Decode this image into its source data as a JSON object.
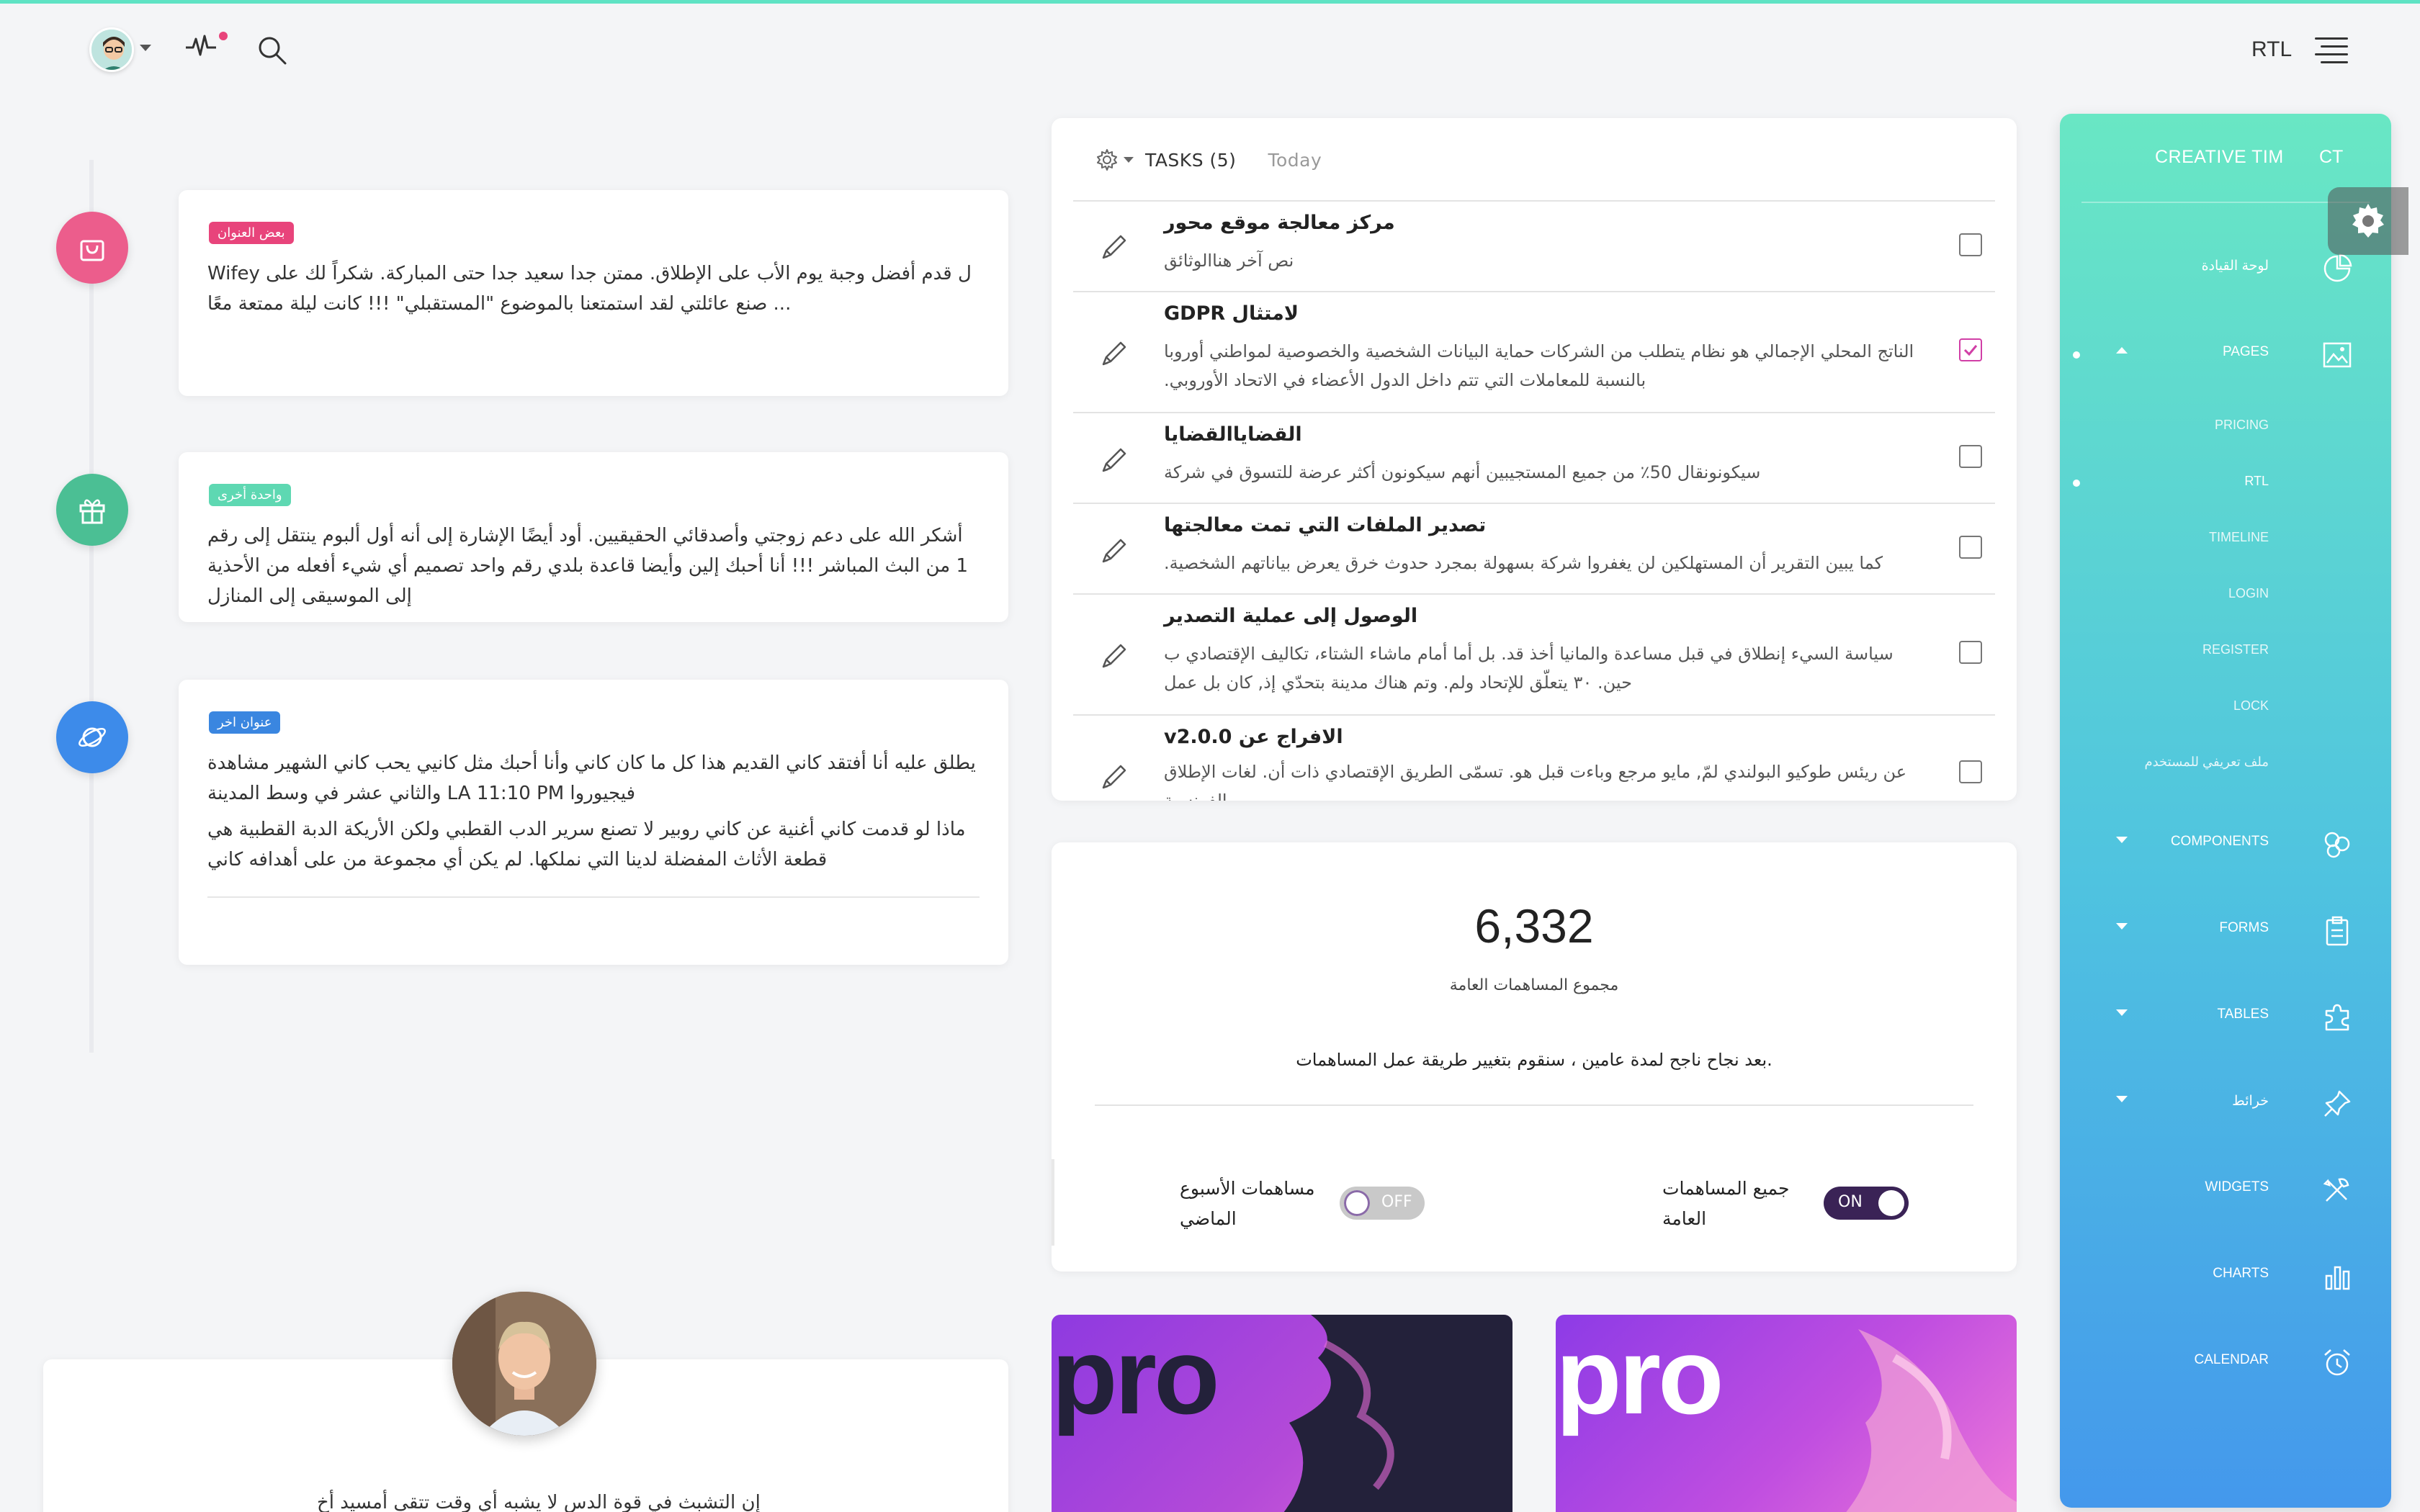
{
  "navbar": {
    "rtl_label": "RTL"
  },
  "timeline": [
    {
      "badge": "بعض العنوان",
      "badge_color": "#e8447b",
      "icon": "shopping-bag-icon",
      "icon_bg": "#ec5d8c",
      "text": "Wifey ل قدم أفضل وجبة يوم الأب على الإطلاق. ممتن جدا سعيد جدا حتى المباركة. شكراً لك على صنع عائلتي لقد استمتعنا بالموضوع \"المستقبلي\" !!! كانت ليلة ممتعة معًا ..."
    },
    {
      "badge": "واحدة أخرى",
      "badge_color": "#5ed8b2",
      "icon": "gift-icon",
      "icon_bg": "#4bbf94",
      "text": "أشكر الله على دعم زوجتي وأصدقائي الحقيقيين. أود أيضًا الإشارة إلى أنه أول ألبوم ينتقل إلى رقم 1 من البث المباشر !!! أنا أحبك إلين وأيضا قاعدة بلدي رقم واحد تصميم أي شيء أفعله من الأحذية إلى الموسيقى إلى المنازل"
    },
    {
      "badge": "عنوان اخر",
      "badge_color": "#3a86e0",
      "icon": "planet-icon",
      "icon_bg": "#3d8bea",
      "text": "يطلق عليه أنا أفتقد كاني القديم هذا كل ما كان كاني وأنا أحبك مثل كانيي يحب كاني الشهير مشاهدة فيجيوروا LA 11:10 PM والثاني عشر في وسط المدينة",
      "text2": "ماذا لو قدمت كاني أغنية عن كاني روبير لا تصنع سرير الدب القطبي ولكن الأريكة الدبة القطبية هي قطعة الأثاث المفضلة لدينا التي نملكها. لم يكن أي مجموعة من على أهدافه كاني"
    }
  ],
  "tasks": {
    "tab_tasks": "TASKS (5)",
    "tab_today": "Today",
    "items": [
      {
        "title": "مركز معالجة موقع محور",
        "text": "نص آخر هناالوثائق",
        "checked": false
      },
      {
        "title": "لامتثال GDPR",
        "text": "الناتج المحلي الإجمالي هو نظام يتطلب من الشركات حماية البيانات الشخصية والخصوصية لمواطني أوروبا بالنسبة للمعاملات التي تتم داخل الدول الأعضاء في الاتحاد الأوروبي.",
        "checked": true
      },
      {
        "title": "القضاياالقضايا",
        "text": "سيكونونقال 50٪ من جميع المستجيبين أنهم سيكونون أكثر عرضة للتسوق في شركة",
        "checked": false
      },
      {
        "title": "تصدير الملفات التي تمت معالجتها",
        "text": "كما يبين التقرير أن المستهلكين لن يغفروا شركة بسهولة بمجرد حدوث خرق يعرض بياناتهم الشخصية.",
        "checked": false
      },
      {
        "title": "الوصول إلى عملية التصدير",
        "text": "سياسة السيء إنطلاق في قبل مساعدة والمانيا أخذ قد. بل أما أمام ماشاء الشتاء، تكاليف الإقتصادي ب حين. ٣٠ يتعلّق للإتحاد ولم. وتم هناك مدينة بتحدّي إذ, كان بل عمل",
        "checked": false
      },
      {
        "title": "الافراج عن v2.0.0",
        "text": "عن ريئس طوكيو البولندي لمّ, مايو مرجع وباءت قبل هو. تسمّى الطريق الإقتصادي ذات أن. لغات الإطلاق الفرنسية",
        "checked": false
      }
    ]
  },
  "stats": {
    "number": "6,332",
    "number_label": "مجموع المساهمات العامة",
    "description": "بعد نجاح ناجح لمدة عامين ، سنقوم بتغيير طريقة عمل المساهمات.",
    "toggle_all_label_1": "جميع المساهمات",
    "toggle_all_label_2": "العامة",
    "toggle_all_state": "ON",
    "toggle_week_label_1": "مساهمات الأسبوع",
    "toggle_week_label_2": "الماضي",
    "toggle_week_state": "OFF"
  },
  "pro_cards": [
    {
      "text": "pro",
      "theme": "dark"
    },
    {
      "text": "pro",
      "theme": "light"
    }
  ],
  "profile": {
    "text": "إن التشبث في قوة الدس لا يشبه أي وقت تتقى أمسيد أخ"
  },
  "sidebar": {
    "brand_mini": "CT",
    "brand": "CREATIVE TIM",
    "items": [
      {
        "label": "لوحة القيادة",
        "icon": "dashboard-pie-icon"
      },
      {
        "label": "PAGES",
        "icon": "image-icon"
      },
      {
        "label": "COMPONENTS",
        "icon": "components-icon"
      },
      {
        "label": "FORMS",
        "icon": "clipboard-icon"
      },
      {
        "label": "TABLES",
        "icon": "puzzle-icon"
      },
      {
        "label": "خرائط",
        "icon": "pin-icon"
      },
      {
        "label": "WIDGETS",
        "icon": "tools-icon"
      },
      {
        "label": "CHARTS",
        "icon": "chart-bars-icon"
      },
      {
        "label": "CALENDAR",
        "icon": "alarm-clock-icon"
      }
    ],
    "pages_sub": [
      {
        "label": "PRICING"
      },
      {
        "label": "RTL"
      },
      {
        "label": "TIMELINE"
      },
      {
        "label": "LOGIN"
      },
      {
        "label": "REGISTER"
      },
      {
        "label": "LOCK"
      },
      {
        "label": "ملف تعريفي للمستخدم"
      }
    ]
  }
}
